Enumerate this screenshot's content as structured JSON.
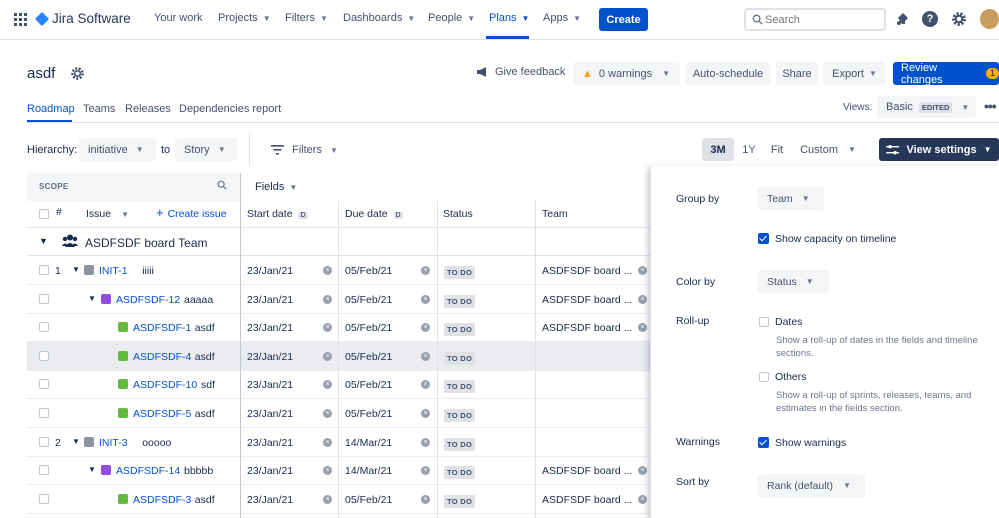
{
  "app": {
    "brand": "Jira Software"
  },
  "nav": [
    {
      "label": "Your work",
      "caret": false
    },
    {
      "label": "Projects",
      "caret": true
    },
    {
      "label": "Filters",
      "caret": true
    },
    {
      "label": "Dashboards",
      "caret": true
    },
    {
      "label": "People",
      "caret": true
    },
    {
      "label": "Plans",
      "caret": true
    },
    {
      "label": "Apps",
      "caret": true
    }
  ],
  "create_label": "Create",
  "search": {
    "placeholder": "Search"
  },
  "plan": {
    "title": "asdf"
  },
  "actions": {
    "feedback": "Give feedback",
    "warnings": "0 warnings",
    "autoschedule": "Auto-schedule",
    "share": "Share",
    "export": "Export",
    "review": "Review changes",
    "review_count": "1"
  },
  "tabs": [
    "Roadmap",
    "Teams",
    "Releases",
    "Dependencies report"
  ],
  "views": {
    "label": "Views:",
    "current": "Basic",
    "badge": "EDITED"
  },
  "hierarchy": {
    "label": "Hierarchy:",
    "from": "initiative",
    "to_label": "to",
    "to": "Story"
  },
  "filters_label": "Filters",
  "zoom": [
    "3M",
    "1Y",
    "Fit",
    "Custom"
  ],
  "view_settings": "View settings",
  "scope_label": "SCOPE",
  "fields_label": "Fields",
  "columns": {
    "num": "#",
    "issue": "Issue",
    "create": "Create issue",
    "start": "Start date",
    "due": "Due date",
    "status": "Status",
    "team": "Team",
    "date_flag": "D"
  },
  "group": {
    "name": "ASDFSDF board Team"
  },
  "rows": [
    {
      "num": "1",
      "key": "INIT-1",
      "summary": "iiiii",
      "type": "initiative",
      "level": 0,
      "start": "23/Jan/21",
      "due": "05/Feb/21",
      "status": "TO DO",
      "team": "ASDFSDF board ..."
    },
    {
      "num": "",
      "key": "ASDFSDF-12",
      "summary": "aaaaa",
      "type": "epic",
      "level": 1,
      "start": "23/Jan/21",
      "due": "05/Feb/21",
      "status": "TO DO",
      "team": "ASDFSDF board ..."
    },
    {
      "num": "",
      "key": "ASDFSDF-1",
      "summary": "asdf",
      "type": "story",
      "level": 2,
      "start": "23/Jan/21",
      "due": "05/Feb/21",
      "status": "TO DO",
      "team": "ASDFSDF board ..."
    },
    {
      "num": "",
      "key": "ASDFSDF-4",
      "summary": "asdf",
      "type": "story",
      "level": 2,
      "start": "23/Jan/21",
      "due": "05/Feb/21",
      "status": "TO DO",
      "team": ""
    },
    {
      "num": "",
      "key": "ASDFSDF-10",
      "summary": "sdf",
      "type": "story",
      "level": 2,
      "start": "23/Jan/21",
      "due": "05/Feb/21",
      "status": "TO DO",
      "team": ""
    },
    {
      "num": "",
      "key": "ASDFSDF-5",
      "summary": "asdf",
      "type": "story",
      "level": 2,
      "start": "23/Jan/21",
      "due": "05/Feb/21",
      "status": "TO DO",
      "team": ""
    },
    {
      "num": "2",
      "key": "INIT-3",
      "summary": "ooooo",
      "type": "initiative",
      "level": 0,
      "start": "23/Jan/21",
      "due": "14/Mar/21",
      "status": "TO DO",
      "team": ""
    },
    {
      "num": "",
      "key": "ASDFSDF-14",
      "summary": "bbbbb",
      "type": "epic",
      "level": 1,
      "start": "23/Jan/21",
      "due": "14/Mar/21",
      "status": "TO DO",
      "team": "ASDFSDF board ..."
    },
    {
      "num": "",
      "key": "ASDFSDF-3",
      "summary": "asdf",
      "type": "story",
      "level": 2,
      "start": "23/Jan/21",
      "due": "05/Feb/21",
      "status": "TO DO",
      "team": "ASDFSDF board ..."
    }
  ],
  "settings": {
    "group_by": {
      "label": "Group by",
      "value": "Team"
    },
    "capacity": {
      "label": "Show capacity on timeline",
      "checked": true
    },
    "color_by": {
      "label": "Color by",
      "value": "Status"
    },
    "rollup": {
      "label": "Roll-up",
      "dates": "Dates",
      "dates_help": "Show a roll-up of dates in the fields and timeline sections.",
      "others": "Others",
      "others_help": "Show a roll-up of sprints, releases, teams, and estimates in the fields section."
    },
    "warnings": {
      "label": "Warnings",
      "check_label": "Show warnings",
      "checked": true
    },
    "sort_by": {
      "label": "Sort by",
      "value": "Rank (default)"
    }
  },
  "colors": {
    "primary": "#0052CC",
    "initiative": "#8993A4",
    "epic": "#904EE2",
    "story": "#63BA3C",
    "selected_row": "#EBECF0"
  }
}
